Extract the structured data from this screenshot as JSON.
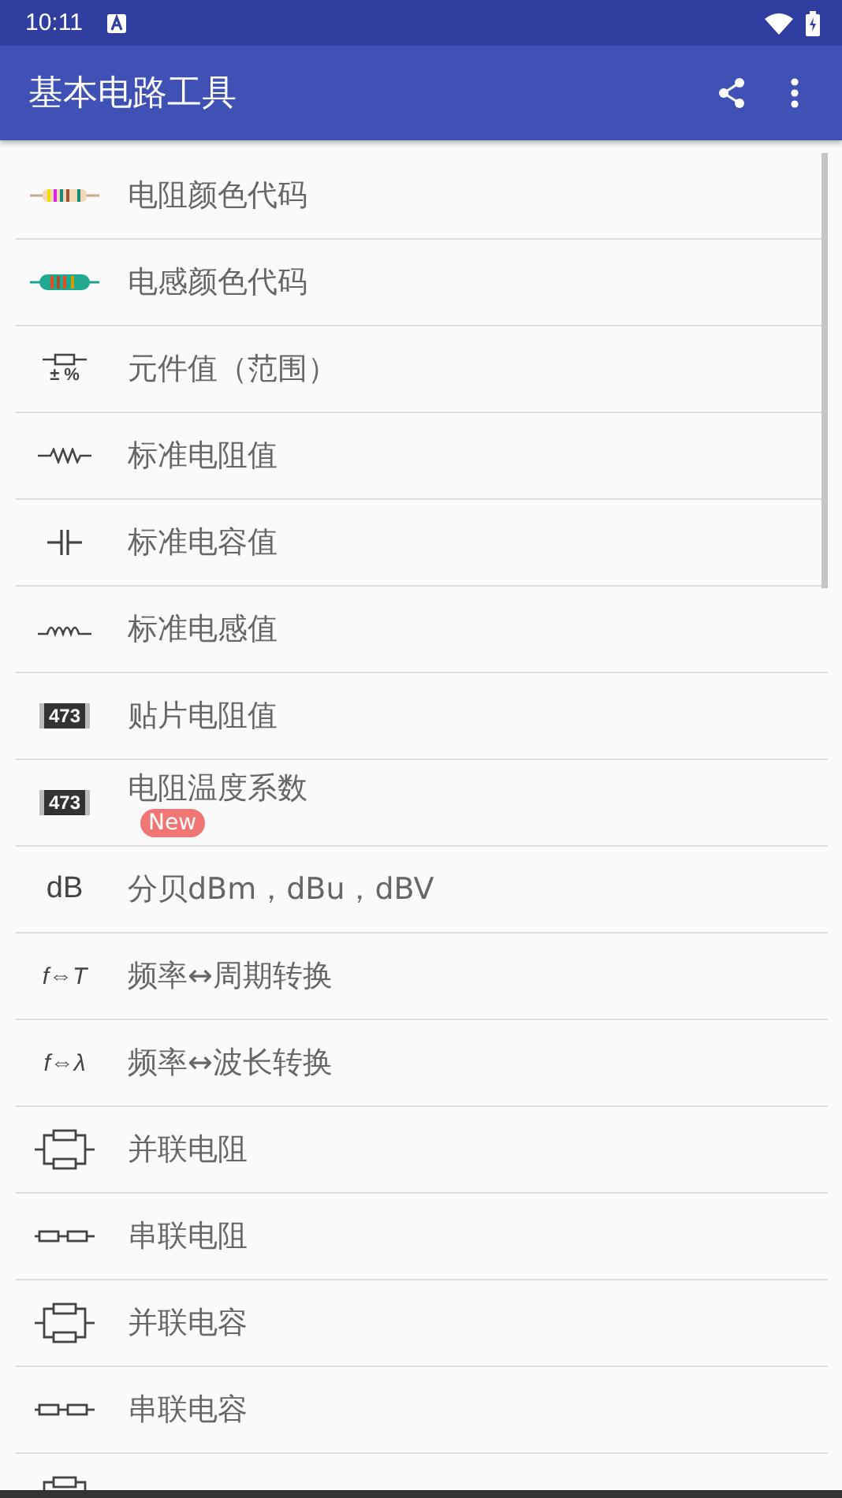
{
  "status_bar": {
    "time": "10:11"
  },
  "app_bar": {
    "title": "基本电路工具"
  },
  "items": [
    {
      "kind": "resistor_color",
      "label": "电阻颜色代码"
    },
    {
      "kind": "inductor_color",
      "label": "电感颜色代码"
    },
    {
      "kind": "tolerance",
      "icon_text": "± %",
      "label": "元件值（范围）"
    },
    {
      "kind": "resistor",
      "label": "标准电阻值"
    },
    {
      "kind": "capacitor",
      "label": "标准电容值"
    },
    {
      "kind": "inductor",
      "label": "标准电感值"
    },
    {
      "kind": "smd",
      "icon_text": "473",
      "label": "贴片电阻值"
    },
    {
      "kind": "smd",
      "icon_text": "473",
      "label": "电阻温度系数",
      "badge": "New"
    },
    {
      "kind": "text",
      "icon_text": "dB",
      "label": "分贝dBm，dBu，dBV"
    },
    {
      "kind": "formula",
      "icon_text": "f⇔T",
      "label": "频率↔周期转换"
    },
    {
      "kind": "formula",
      "icon_text": "f⇔λ",
      "label": "频率↔波长转换"
    },
    {
      "kind": "parallel",
      "label": "并联电阻"
    },
    {
      "kind": "series",
      "label": "串联电阻"
    },
    {
      "kind": "parallel",
      "label": "并联电容"
    },
    {
      "kind": "series",
      "label": "串联电容"
    },
    {
      "kind": "parallel"
    }
  ]
}
